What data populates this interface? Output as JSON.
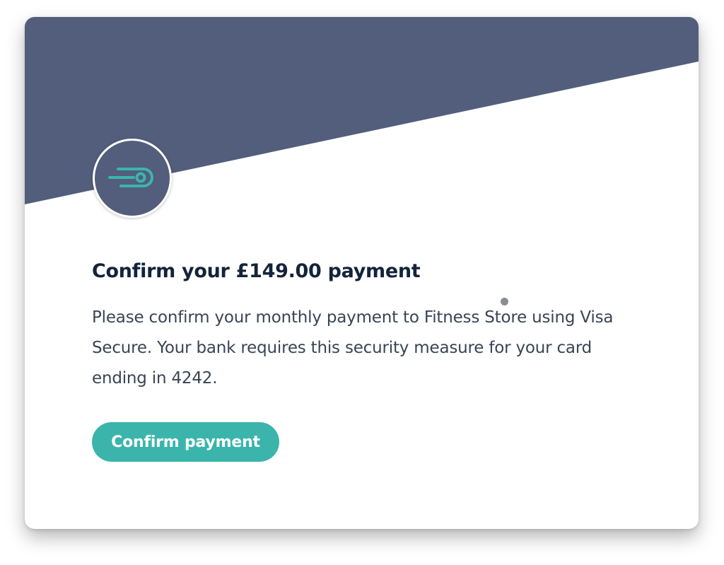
{
  "colors": {
    "header_band": "#525e7b",
    "accent": "#3bb5ab",
    "title_text": "#13233a",
    "body_text": "#3a4455",
    "card_background": "#ffffff"
  },
  "logo": {
    "icon": "speed-card-icon"
  },
  "payment": {
    "title": "Confirm your £149.00 payment",
    "description": "Please confirm your monthly payment to Fitness Store using Visa Secure. Your bank requires this security measure for your card ending in 4242.",
    "confirm_label": "Confirm payment"
  }
}
